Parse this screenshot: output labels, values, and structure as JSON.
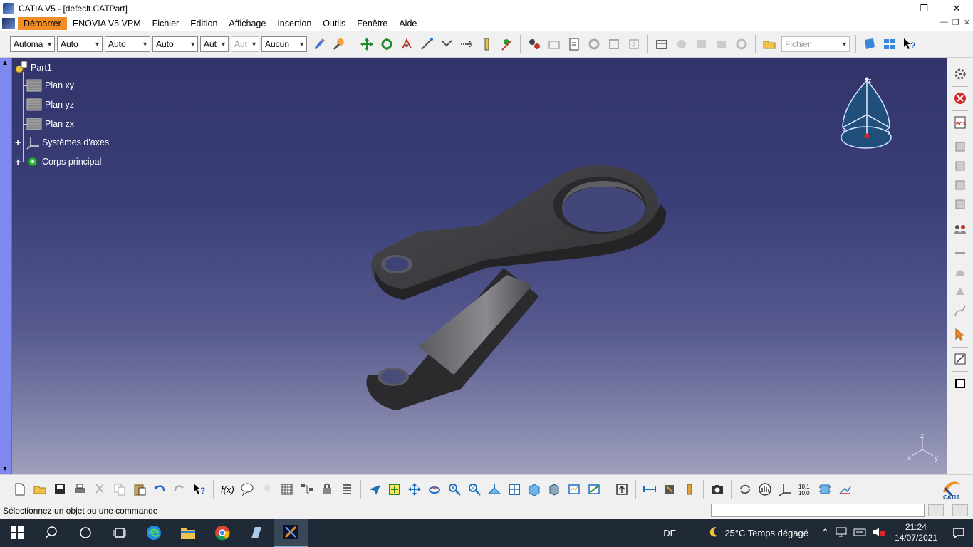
{
  "window": {
    "title": "CATIA V5 - [defeclt.CATPart]",
    "minimize": "—",
    "maximize": "❐",
    "close": "✕"
  },
  "menu": {
    "items": [
      "Démarrer",
      "ENOVIA V5 VPM",
      "Fichier",
      "Edition",
      "Affichage",
      "Insertion",
      "Outils",
      "Fenêtre",
      "Aide"
    ]
  },
  "toolbar_top": {
    "combos": [
      {
        "value": "Automa",
        "disabled": false
      },
      {
        "value": "Auto",
        "disabled": false
      },
      {
        "value": "Auto",
        "disabled": false
      },
      {
        "value": "Auto",
        "disabled": false
      },
      {
        "value": "Aut",
        "disabled": false
      },
      {
        "value": "Aut",
        "disabled": true
      },
      {
        "value": "Aucun",
        "disabled": false
      }
    ],
    "file_combo": "Fichier"
  },
  "tree": {
    "root": "Part1",
    "items": [
      "Plan xy",
      "Plan yz",
      "Plan zx",
      "Systèmes d'axes",
      "Corps principal"
    ]
  },
  "compass": {
    "x_label": "x",
    "y_label": "y",
    "z_label": "z"
  },
  "triad": {
    "x_label": "x",
    "y_label": "y",
    "z_label": "z"
  },
  "status": {
    "message": "Sélectionnez un objet ou une commande"
  },
  "taskbar": {
    "language": "DE",
    "weather": "25°C  Temps dégagé",
    "time": "21:24",
    "date": "14/07/2021"
  },
  "colors": {
    "viewport_top": "#32346a",
    "viewport_bottom": "#9fa0bd",
    "menu_active": "#f28c24",
    "left_scroll": "#7f88ee",
    "part": "#3a3a3d"
  }
}
